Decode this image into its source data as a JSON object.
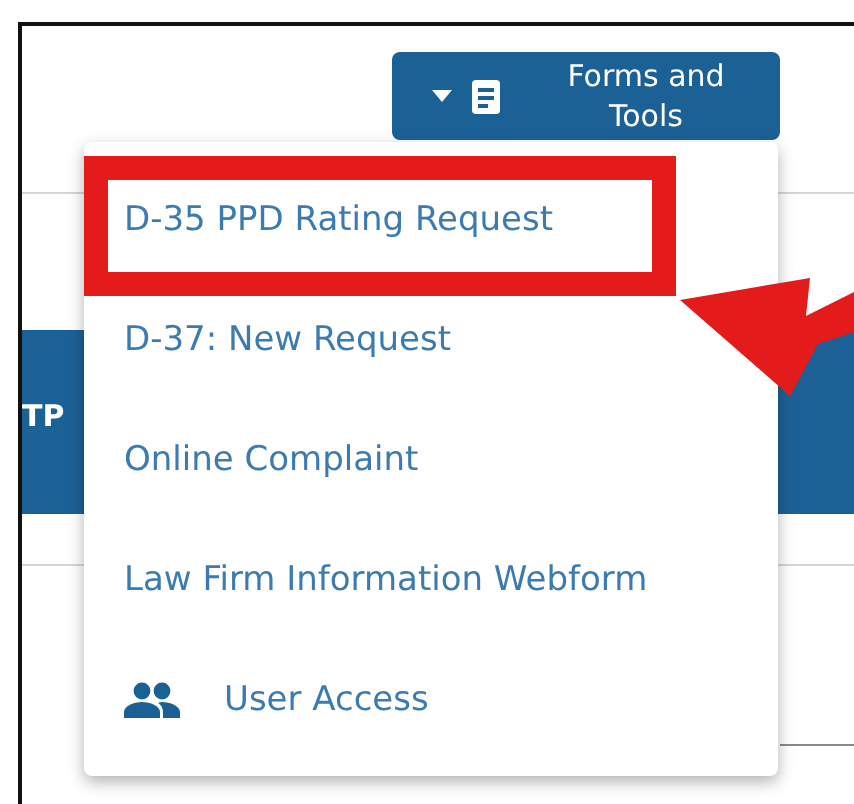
{
  "toolbar": {
    "button": {
      "label": "Forms and Tools"
    }
  },
  "banner": {
    "label": "TP"
  },
  "dropdown": {
    "items": [
      {
        "kind": "link",
        "label": "D-35 PPD Rating Request",
        "highlighted": true
      },
      {
        "kind": "link",
        "label": "D-37: New Request",
        "highlighted": false
      },
      {
        "kind": "link",
        "label": "Online Complaint",
        "highlighted": false
      },
      {
        "kind": "link",
        "label": "Law Firm Information Webform",
        "highlighted": false
      },
      {
        "kind": "icon",
        "label": "User Access",
        "highlighted": false
      }
    ]
  }
}
